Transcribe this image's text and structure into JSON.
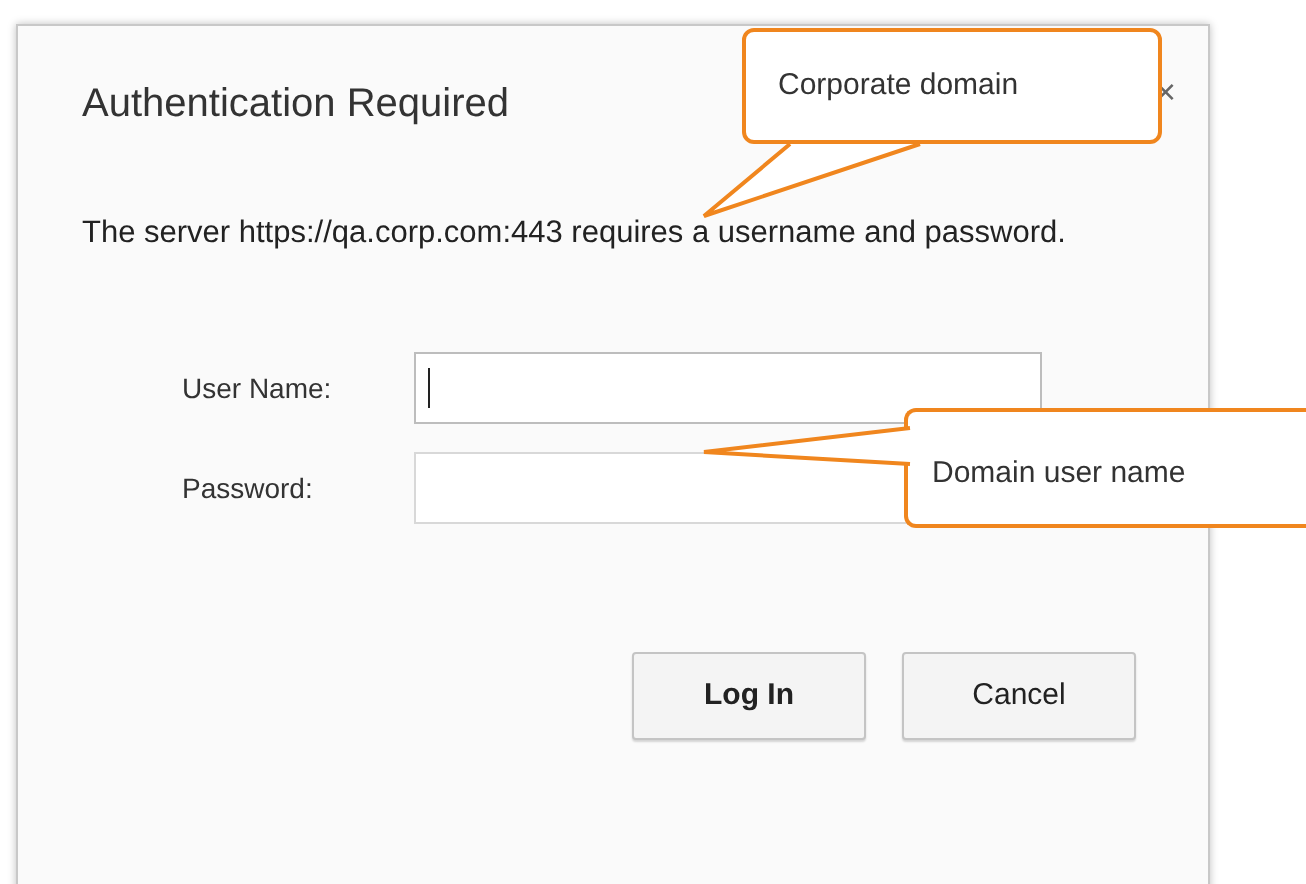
{
  "dialog": {
    "title": "Authentication Required",
    "close": "×",
    "message": "The server https://qa.corp.com:443 requires a username and password."
  },
  "fields": [
    {
      "label": "User Name:",
      "focused": true
    },
    {
      "label": "Password:",
      "focused": false
    }
  ],
  "buttons": [
    {
      "label": "Log In",
      "kind": "primary"
    },
    {
      "label": "Cancel",
      "kind": "secondary"
    }
  ],
  "callouts": [
    {
      "text": "Corporate domain",
      "kind": "above"
    },
    {
      "text": "Domain user name",
      "kind": "right"
    }
  ]
}
